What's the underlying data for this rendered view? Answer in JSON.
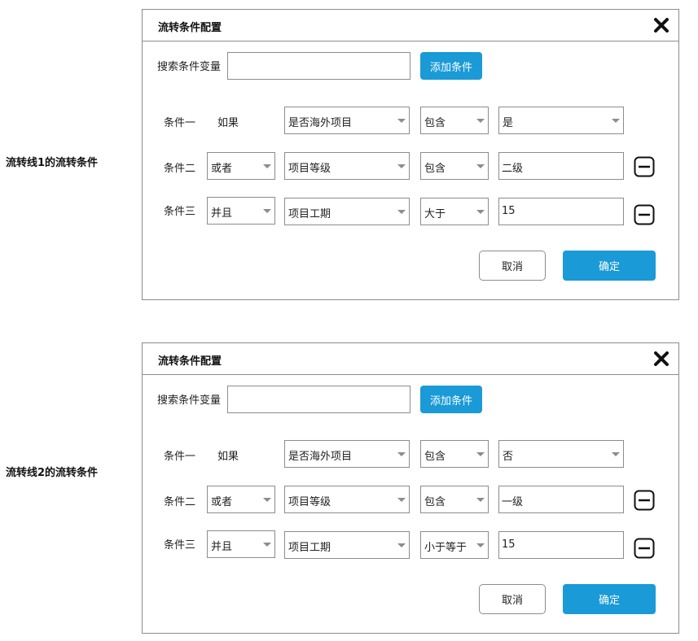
{
  "dialogs": [
    {
      "side_label": "流转线1的流转条件",
      "title": "流转条件配置",
      "search_label": "搜索条件变量",
      "search_value": "",
      "add_button": "添加条件",
      "conditions": [
        {
          "label": "条件一",
          "logic": "如果",
          "field": "是否海外项目",
          "operator": "包含",
          "value": "是",
          "value_is_select": true
        },
        {
          "label": "条件二",
          "logic": "或者",
          "field": "项目等级",
          "operator": "包含",
          "value": "二级",
          "value_is_select": false
        },
        {
          "label": "条件三",
          "logic": "并且",
          "field": "项目工期",
          "operator": "大于",
          "value": "15",
          "value_is_select": false
        }
      ],
      "cancel_button": "取消",
      "ok_button": "确定"
    },
    {
      "side_label": "流转线2的流转条件",
      "title": "流转条件配置",
      "search_label": "搜索条件变量",
      "search_value": "",
      "add_button": "添加条件",
      "conditions": [
        {
          "label": "条件一",
          "logic": "如果",
          "field": "是否海外项目",
          "operator": "包含",
          "value": "否",
          "value_is_select": true
        },
        {
          "label": "条件二",
          "logic": "或者",
          "field": "项目等级",
          "operator": "包含",
          "value": "一级",
          "value_is_select": false
        },
        {
          "label": "条件三",
          "logic": "并且",
          "field": "项目工期",
          "operator": "小于等于",
          "value": "15",
          "value_is_select": false
        }
      ],
      "cancel_button": "取消",
      "ok_button": "确定"
    }
  ],
  "icons": {
    "close": "close-icon",
    "remove": "minus-square-icon"
  },
  "colors": {
    "primary": "#1a9ad7",
    "border": "#8c8c8c"
  }
}
